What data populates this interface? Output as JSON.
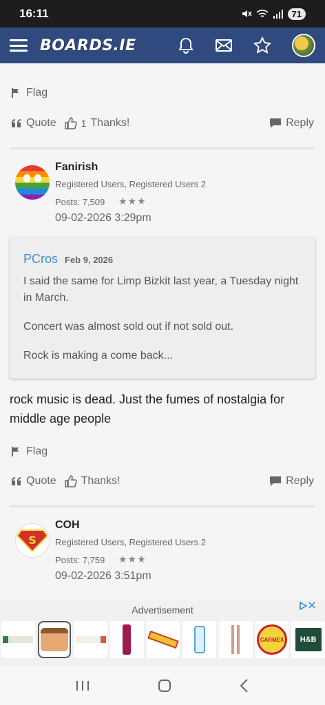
{
  "status_bar": {
    "time": "16:11",
    "battery": "71"
  },
  "app_bar": {
    "logo": "BOARDS.IE"
  },
  "post1_actions": {
    "flag": "Flag",
    "quote": "Quote",
    "thanks_count": "1",
    "thanks": "Thanks!",
    "reply": "Reply"
  },
  "post2": {
    "username": "Fanirish",
    "role": "Registered Users, Registered Users 2",
    "posts": "Posts: 7,509",
    "stars": "★★★",
    "date": "09-02-2026 3:29pm",
    "quote": {
      "author": "PCros",
      "date": "Feb 9, 2026",
      "paragraphs": [
        "I said the same for Limp Bizkit last year, a Tuesday night in March.",
        "Concert was almost sold out if not sold out.",
        "Rock is making a come back..."
      ]
    },
    "body": "rock music is dead. Just the fumes of nostalgia for middle age people",
    "actions": {
      "flag": "Flag",
      "quote": "Quote",
      "thanks": "Thanks!",
      "reply": "Reply"
    }
  },
  "post3": {
    "username": "COH",
    "role": "Registered Users, Registered Users 2",
    "posts": "Posts: 7,759",
    "stars": "★★★",
    "date": "09-02-2026 3:51pm"
  },
  "ad": {
    "label": "Advertisement",
    "brand": "H&B",
    "carmex": "CARMEX"
  },
  "colors": {
    "app_bar": "#304a80",
    "link": "#3f8fd6",
    "status_bar": "#1d1d1f"
  }
}
